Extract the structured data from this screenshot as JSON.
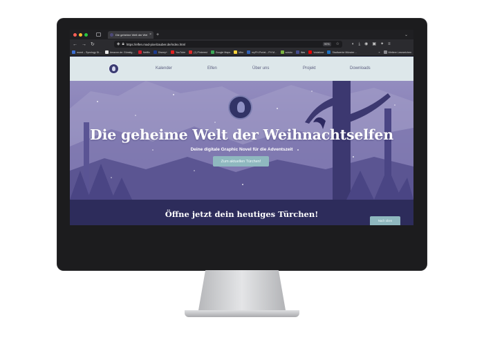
{
  "browser": {
    "tab_title": "Die geheime Welt der Weihnachtselfen",
    "tab_close": "×",
    "new_tab": "+",
    "url": "https://elfen.mad-pixelzauber.de/index.html",
    "zoom": "90%",
    "bookmarks": [
      {
        "label": "mond – Synology Di…",
        "color": "#3b6fd1",
        "icon": "synology-icon"
      },
      {
        "label": "Amazon.de: Günstig…",
        "color": "#e8e8e8",
        "icon": "amazon-icon"
      },
      {
        "label": "Netflix",
        "color": "#d11b2b",
        "icon": "netflix-icon"
      },
      {
        "label": "Disney+",
        "color": "#1a3a8c",
        "icon": "disney-icon"
      },
      {
        "label": "YouTube",
        "color": "#e02020",
        "icon": "youtube-icon"
      },
      {
        "label": "(1) Pinterest",
        "color": "#d92b2b",
        "icon": "pinterest-icon"
      },
      {
        "label": "Google Maps",
        "color": "#3aa757",
        "icon": "maps-icon"
      },
      {
        "label": "Miro",
        "color": "#f5d23b",
        "icon": "miro-icon"
      },
      {
        "label": "myFH-Portal – FH M…",
        "color": "#2f5fb3",
        "icon": "portal-icon"
      },
      {
        "label": "scisbo",
        "color": "#7bb342",
        "icon": "scisbo-icon"
      },
      {
        "label": "Ilias",
        "color": "#444b8c",
        "icon": "ilias-icon"
      },
      {
        "label": "Vodafone",
        "color": "#e60000",
        "icon": "vodafone-icon"
      },
      {
        "label": "Stadtwerke Münster…",
        "color": "#1b6fbf",
        "icon": "stadtwerke-icon"
      }
    ],
    "more_bookmarks": "»",
    "other_bookmarks": "Weitere Lesezeichen"
  },
  "site": {
    "nav": [
      "Kalender",
      "Elfen",
      "Über uns",
      "Projekt",
      "Downloads"
    ],
    "hero_title": "Die geheime Welt der Weihnachtselfen",
    "hero_subtitle": "Deine digitale Graphic Novel für die Adventszeit",
    "hero_button": "Zum aktuellen Türchen!",
    "section_title": "Öffne jetzt dein heutiges Türchen!",
    "section_button": "Nach oben"
  },
  "colors": {
    "nav_bg": "#dde7ea",
    "hero_bg": "#857fb5",
    "section_bg": "#2d2c5b",
    "button": "#8fb8bf"
  }
}
